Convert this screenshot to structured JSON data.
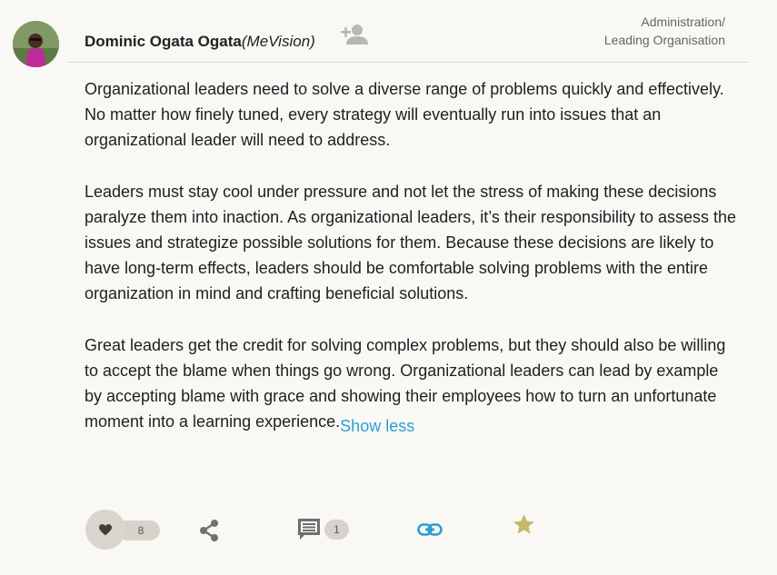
{
  "post": {
    "author_name": "Dominic Ogata Ogata",
    "author_org": "(MeVision)",
    "breadcrumb_line1": "Administration/",
    "breadcrumb_line2": "Leading Organisation",
    "paragraphs": [
      "Organizational leaders need to solve a diverse range of problems quickly and effectively. No matter how finely tuned, every strategy will eventually run into issues that an organizational leader will need to address.",
      "Leaders must stay cool under pressure and not let the stress of making these decisions paralyze them into inaction. As organizational leaders, it’s their responsibility to assess the issues and strategize possible solutions for them. Because these decisions are likely to have long-term effects, leaders should be comfortable solving problems with the entire organization in mind and crafting beneficial solutions.",
      "Great leaders get the credit for solving complex problems, but they should also be willing to accept the blame when things go wrong. Organizational leaders can lead by example by accepting blame with grace and showing their employees how to turn an unfortunate moment into a learning experience."
    ],
    "show_less_label": "Show less"
  },
  "actions": {
    "like_count": "8",
    "comment_count": "1"
  },
  "icons": {
    "follow": "person-add-icon",
    "like": "heart-icon",
    "share": "share-icon",
    "comment": "comment-icon",
    "link": "link-icon",
    "bookmark": "star-icon"
  },
  "colors": {
    "background": "#f9f8f5",
    "accent_blue": "#2a9fd6",
    "icon_grey": "#777777",
    "star_gold": "#c8b66a",
    "pill_bg": "#d6d3ca"
  }
}
